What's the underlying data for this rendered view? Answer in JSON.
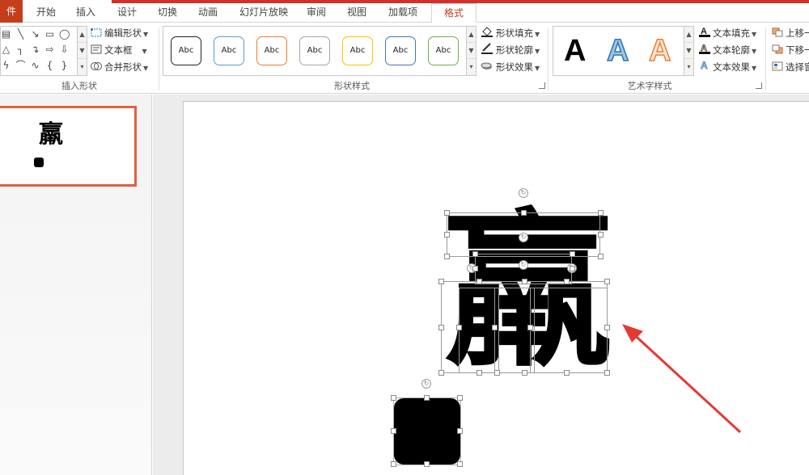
{
  "tabs": [
    {
      "label": "件"
    },
    {
      "label": "开始"
    },
    {
      "label": "插入"
    },
    {
      "label": "设计"
    },
    {
      "label": "切换"
    },
    {
      "label": "动画"
    },
    {
      "label": "幻灯片放映"
    },
    {
      "label": "审阅"
    },
    {
      "label": "视图"
    },
    {
      "label": "加载项"
    },
    {
      "label": "格式"
    }
  ],
  "colors": {
    "accent": "#c43e1c",
    "red_bar": "#d32f2f",
    "thumb_border": "#e06040",
    "arrow": "#e53935"
  },
  "ribbon": {
    "insert_shapes": {
      "group_label": "插入形状",
      "edit_shape": "编辑形状",
      "text_box": "文本框",
      "merge_shapes": "合并形状"
    },
    "shape_styles": {
      "group_label": "形状样式",
      "presets": [
        "Abc",
        "Abc",
        "Abc",
        "Abc",
        "Abc",
        "Abc",
        "Abc"
      ],
      "preset_colors": [
        "#222222",
        "#5b9bd5",
        "#ed7d31",
        "#a5a5a5",
        "#ffc000",
        "#4472c4",
        "#70ad47"
      ],
      "fill": "形状填充",
      "outline": "形状轮廓",
      "effects": "形状效果"
    },
    "wordart": {
      "group_label": "艺术字样式",
      "samples": [
        "A",
        "A",
        "A"
      ],
      "text_fill": "文本填充",
      "text_outline": "文本轮廓",
      "text_effects": "文本效果"
    },
    "arrange": {
      "bring_forward": "上移一",
      "send_backward": "下移一",
      "selection_pane": "选择窗"
    }
  },
  "thumbnail": {
    "char": "羸"
  },
  "slide": {
    "char": "羸"
  }
}
